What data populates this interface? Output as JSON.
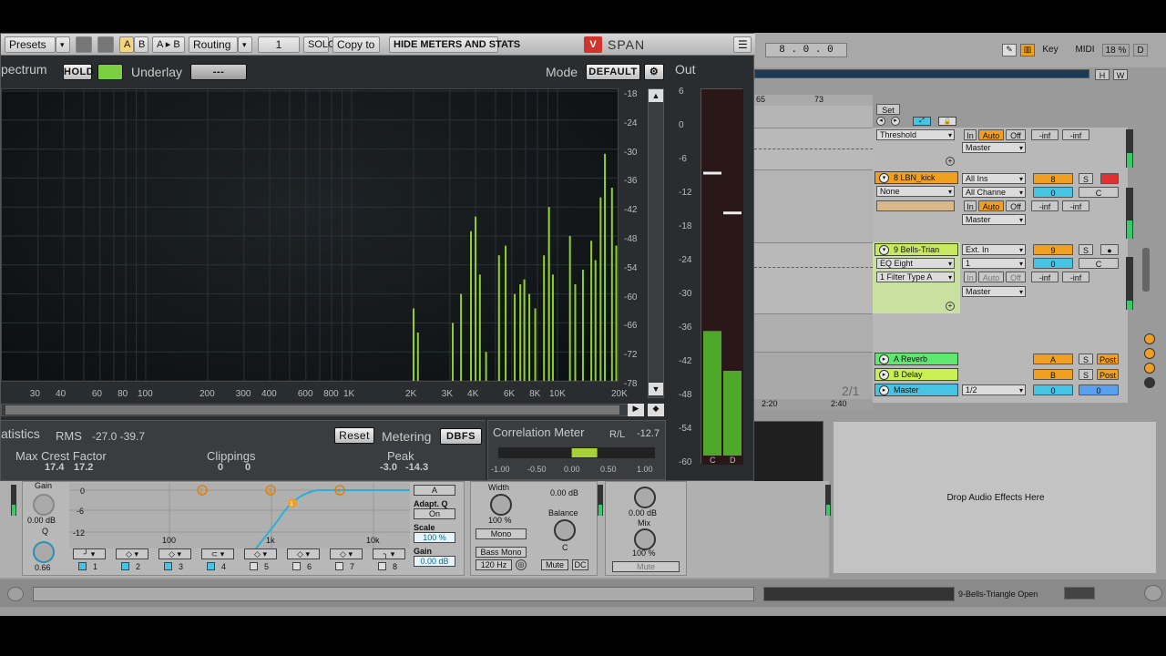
{
  "plugin": {
    "toolbar": {
      "presets": "Presets",
      "a": "A",
      "b": "B",
      "ab": "A ▸ B",
      "routing": "Routing",
      "routing_value": "1",
      "solo": "SOLO",
      "copy_to": "Copy to",
      "hide_meters": "HIDE METERS AND STATS",
      "brand": "SPAN"
    },
    "spectrum_label": "pectrum",
    "hold": "HOLD",
    "underlay": "Underlay",
    "underlay_value": "---",
    "mode_label": "Mode",
    "mode_value": "DEFAULT",
    "db_ticks": [
      "-18",
      "-24",
      "-30",
      "-36",
      "-42",
      "-48",
      "-54",
      "-60",
      "-66",
      "-72",
      "-78"
    ],
    "freq_ticks": [
      "30",
      "40",
      "60",
      "80",
      "100",
      "200",
      "300",
      "400",
      "600",
      "800",
      "1K",
      "2K",
      "3K",
      "4K",
      "6K",
      "8K",
      "10K",
      "20K"
    ],
    "out_label": "Out",
    "out_ticks": [
      "6",
      "0",
      "-6",
      "-12",
      "-18",
      "-24",
      "-30",
      "-36",
      "-42",
      "-48",
      "-54",
      "-60"
    ],
    "out_channels": [
      "C",
      "D"
    ],
    "out_levels": {
      "C": -36.5,
      "D": -43.5
    },
    "out_peaks": {
      "C": -8.5,
      "D": -15.5
    },
    "stats_label": "atistics",
    "rms_label": "RMS",
    "rms_values": "-27.0  -39.7",
    "reset": "Reset",
    "metering_label": "Metering",
    "metering_value": "DBFS",
    "max_crest_label": "Max Crest Factor",
    "max_crest_values": [
      "17.4",
      "17.2"
    ],
    "clippings_label": "Clippings",
    "clippings_values": [
      "0",
      "0"
    ],
    "peak_label": "Peak",
    "peak_values": [
      "-3.0",
      "-14.3"
    ],
    "correlation_label": "Correlation Meter",
    "rl_label": "R/L",
    "rl_value": "-12.7",
    "corr_ticks": [
      "-1.00",
      "-0.50",
      "0.00",
      "0.50",
      "1.00"
    ],
    "correlation_value": 0.1
  },
  "live": {
    "position": "8 . 0 . 0",
    "key": "Key",
    "midi": "MIDI",
    "cpu": "18 %",
    "d": "D",
    "h": "H",
    "w": "W",
    "ruler": [
      "65",
      "73"
    ],
    "ruler_bottom": [
      "2:20",
      "2:40"
    ],
    "page": "2/1",
    "set": "Set",
    "threshold": "Threshold",
    "tracks": [
      {
        "name": "8 LBN_kick",
        "input": "All Ins",
        "monitor": "All Channe",
        "device": "None",
        "num": "8",
        "vol": "0",
        "pan": "C",
        "color": "#f0a020"
      },
      {
        "name": "9 Bells-Trian",
        "input": "Ext. In",
        "monitor": "1",
        "device": "EQ Eight",
        "param": "1 Filter Type A",
        "num": "9",
        "vol": "0",
        "pan": "C",
        "color": "#c8e860"
      }
    ],
    "returns": [
      {
        "name": "A Reverb",
        "letter": "A",
        "post": "Post"
      },
      {
        "name": "B Delay",
        "letter": "B",
        "post": "Post"
      }
    ],
    "master": "Master",
    "master_ratio": "1/2",
    "master_vol": "0",
    "master_pan": "0",
    "in": "In",
    "auto": "Auto",
    "off": "Off",
    "inf": "-inf",
    "s": "S",
    "drop_text": "Drop Audio Effects Here",
    "status_track": "9-Bells-Triangle Open",
    "none": "none"
  },
  "eq": {
    "gain_label": "Gain",
    "gain_value": "0.00 dB",
    "q_label": "Q",
    "q_value": "0.66",
    "grid_db": [
      "0",
      "-6",
      "-12"
    ],
    "grid_freq": [
      "100",
      "1k",
      "10k"
    ],
    "bands": [
      "1",
      "2",
      "3",
      "4",
      "5",
      "6",
      "7",
      "8"
    ],
    "a_btn": "A",
    "adapt_q": "Adapt. Q",
    "adapt_on": "On",
    "scale_label": "Scale",
    "scale_value": "100 %",
    "gain2_label": "Gain",
    "gain2_value": "0.00 dB",
    "width_label": "Width",
    "width_value": "100 %",
    "mono": "Mono",
    "bass_mono": "Bass Mono",
    "bass_freq": "120 Hz",
    "util_gain": "0.00 dB",
    "balance_label": "Balance",
    "balance_value": "C",
    "mute": "Mute",
    "dc": "DC",
    "dev_gain": "0.00 dB",
    "mix_label": "Mix",
    "mix_value": "100 %",
    "mute2": "Mute"
  }
}
